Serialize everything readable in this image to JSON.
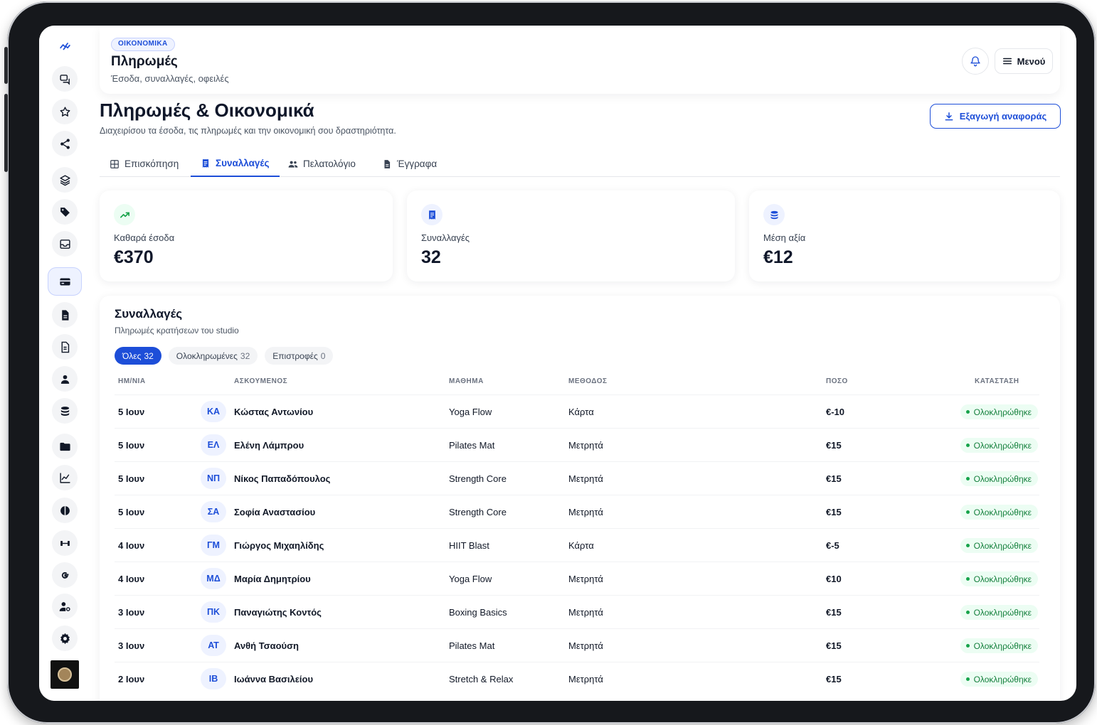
{
  "header": {
    "badge": "ΟΙΚΟΝΟΜΙΚΑ",
    "title": "Πληρωμές",
    "subtitle": "Έσοδα, συναλλαγές, οφειλές",
    "menu_label": "Μενού"
  },
  "page": {
    "title": "Πληρωμές & Οικονομικά",
    "subtitle": "Διαχειρίσου τα έσοδα, τις πληρωμές και την οικονομική σου δραστηριότητα.",
    "export_label": "Εξαγωγή αναφοράς"
  },
  "tabs": [
    {
      "label": "Επισκόπηση",
      "icon": "grid-icon"
    },
    {
      "label": "Συναλλαγές",
      "icon": "receipt-icon",
      "active": true
    },
    {
      "label": "Πελατολόγιο",
      "icon": "users-icon"
    },
    {
      "label": "Έγγραφα",
      "icon": "document-icon"
    }
  ],
  "stats": [
    {
      "label": "Καθαρά έσοδα",
      "value": "€370",
      "icon": "trending-up-icon",
      "color": "#16a34a"
    },
    {
      "label": "Συναλλαγές",
      "value": "32",
      "icon": "receipt-icon",
      "color": "#1d4ed8"
    },
    {
      "label": "Μέση αξία",
      "value": "€12",
      "icon": "coins-icon",
      "color": "#1d4ed8"
    }
  ],
  "transactions": {
    "title": "Συναλλαγές",
    "subtitle": "Πληρωμές κρατήσεων του studio",
    "filters": [
      {
        "label": "Όλες",
        "count": "32",
        "active": true
      },
      {
        "label": "Ολοκληρωμένες",
        "count": "32"
      },
      {
        "label": "Επιστροφές",
        "count": "0"
      }
    ],
    "columns": {
      "date": "ΗΜ/ΝΙΑ",
      "client": "ΑΣΚΟΥΜΕΝΟΣ",
      "class": "ΜΑΘΗΜΑ",
      "method": "ΜΕΘΟΔΟΣ",
      "amount": "ΠΟΣΟ",
      "status": "ΚΑΤΑΣΤΑΣΗ"
    },
    "rows": [
      {
        "date": "5 Ιουν",
        "initials": "ΚΑ",
        "name": "Κώστας Αντωνίου",
        "class": "Yoga Flow",
        "method": "Κάρτα",
        "amount": "€-10",
        "status": "Ολοκληρώθηκε"
      },
      {
        "date": "5 Ιουν",
        "initials": "ΕΛ",
        "name": "Ελένη Λάμπρου",
        "class": "Pilates Mat",
        "method": "Μετρητά",
        "amount": "€15",
        "status": "Ολοκληρώθηκε"
      },
      {
        "date": "5 Ιουν",
        "initials": "ΝΠ",
        "name": "Νίκος Παπαδόπουλος",
        "class": "Strength Core",
        "method": "Μετρητά",
        "amount": "€15",
        "status": "Ολοκληρώθηκε"
      },
      {
        "date": "5 Ιουν",
        "initials": "ΣΑ",
        "name": "Σοφία Αναστασίου",
        "class": "Strength Core",
        "method": "Μετρητά",
        "amount": "€15",
        "status": "Ολοκληρώθηκε"
      },
      {
        "date": "4 Ιουν",
        "initials": "ΓΜ",
        "name": "Γιώργος Μιχαηλίδης",
        "class": "HIIT Blast",
        "method": "Κάρτα",
        "amount": "€-5",
        "status": "Ολοκληρώθηκε"
      },
      {
        "date": "4 Ιουν",
        "initials": "ΜΔ",
        "name": "Μαρία Δημητρίου",
        "class": "Yoga Flow",
        "method": "Μετρητά",
        "amount": "€10",
        "status": "Ολοκληρώθηκε"
      },
      {
        "date": "3 Ιουν",
        "initials": "ΠΚ",
        "name": "Παναγιώτης Κοντός",
        "class": "Boxing Basics",
        "method": "Μετρητά",
        "amount": "€15",
        "status": "Ολοκληρώθηκε"
      },
      {
        "date": "3 Ιουν",
        "initials": "ΑΤ",
        "name": "Ανθή Τσαούση",
        "class": "Pilates Mat",
        "method": "Μετρητά",
        "amount": "€15",
        "status": "Ολοκληρώθηκε"
      },
      {
        "date": "2 Ιουν",
        "initials": "ΙΒ",
        "name": "Ιωάννα Βασιλείου",
        "class": "Stretch & Relax",
        "method": "Μετρητά",
        "amount": "€15",
        "status": "Ολοκληρώθηκε"
      }
    ]
  },
  "sidebar_icons": [
    "logo-icon",
    "chat-icon",
    "star-icon",
    "share-icon",
    "layers-icon",
    "tag-icon",
    "inbox-icon",
    "credit-card-icon",
    "file-icon",
    "document-icon",
    "user-icon",
    "coins-icon",
    "folder-icon",
    "chart-icon",
    "half-circle-icon",
    "dumbbell-icon",
    "google-icon",
    "user-gear-icon",
    "gear-icon"
  ],
  "colors": {
    "accent": "#1d4ed8",
    "success": "#16a34a"
  }
}
